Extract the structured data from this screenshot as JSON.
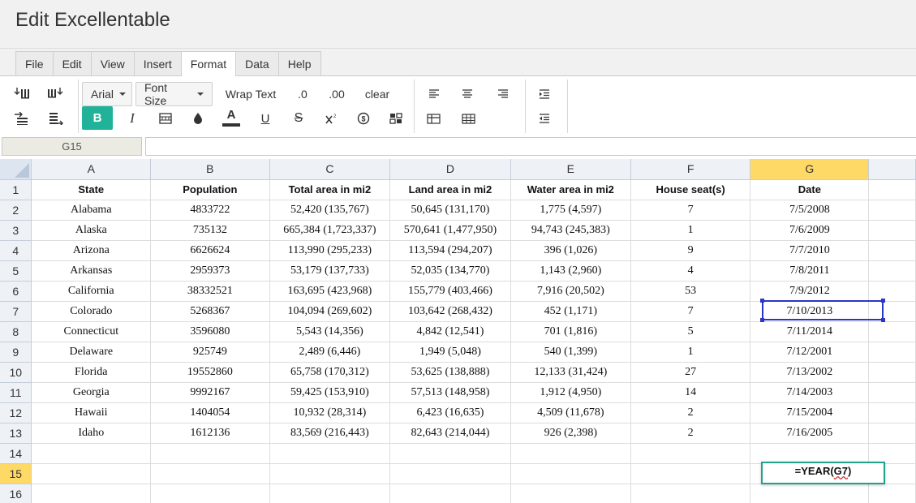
{
  "app": {
    "title": "Edit Excellentable"
  },
  "menu": {
    "items": [
      {
        "label": "File",
        "active": false
      },
      {
        "label": "Edit",
        "active": false
      },
      {
        "label": "View",
        "active": false
      },
      {
        "label": "Insert",
        "active": false
      },
      {
        "label": "Format",
        "active": true
      },
      {
        "label": "Data",
        "active": false
      },
      {
        "label": "Help",
        "active": false
      }
    ]
  },
  "toolbar": {
    "font_family": "Arial",
    "font_size_label": "Font Size",
    "wrap_text_label": "Wrap Text",
    "decrease_decimal_label": ".0",
    "increase_decimal_label": ".00",
    "clear_label": "clear",
    "bold_label": "B",
    "italic_label": "I",
    "text_color_label": "A",
    "underline_label": "U",
    "strike_label": "S",
    "accent_color": "#21b39a"
  },
  "formula_bar": {
    "cell_ref": "G15",
    "value": ""
  },
  "grid": {
    "columns": [
      "A",
      "B",
      "C",
      "D",
      "E",
      "F",
      "G"
    ],
    "selected_column": "G",
    "selected_row": 15,
    "selected_cell": "G7",
    "editing_cell": "G15",
    "editing_value_prefix": "=YEAR(",
    "editing_value_ref": "G7",
    "editing_value_suffix": ")",
    "row_numbers": [
      "1",
      "2",
      "3",
      "4",
      "5",
      "6",
      "7",
      "8",
      "9",
      "10",
      "11",
      "12",
      "13",
      "14",
      "15",
      "16"
    ],
    "header": [
      "State",
      "Population",
      "Total area in mi2",
      "Land area in mi2",
      "Water area in mi2",
      "House seat(s)",
      "Date"
    ],
    "rows": [
      [
        "Alabama",
        "4833722",
        "52,420 (135,767)",
        "50,645 (131,170)",
        "1,775 (4,597)",
        "7",
        "7/5/2008"
      ],
      [
        "Alaska",
        "735132",
        "665,384 (1,723,337)",
        "570,641 (1,477,950)",
        "94,743 (245,383)",
        "1",
        "7/6/2009"
      ],
      [
        "Arizona",
        "6626624",
        "113,990 (295,233)",
        "113,594 (294,207)",
        "396 (1,026)",
        "9",
        "7/7/2010"
      ],
      [
        "Arkansas",
        "2959373",
        "53,179 (137,733)",
        "52,035 (134,770)",
        "1,143 (2,960)",
        "4",
        "7/8/2011"
      ],
      [
        "California",
        "38332521",
        "163,695 (423,968)",
        "155,779 (403,466)",
        "7,916 (20,502)",
        "53",
        "7/9/2012"
      ],
      [
        "Colorado",
        "5268367",
        "104,094 (269,602)",
        "103,642 (268,432)",
        "452 (1,171)",
        "7",
        "7/10/2013"
      ],
      [
        "Connecticut",
        "3596080",
        "5,543 (14,356)",
        "4,842 (12,541)",
        "701 (1,816)",
        "5",
        "7/11/2014"
      ],
      [
        "Delaware",
        "925749",
        "2,489 (6,446)",
        "1,949 (5,048)",
        "540 (1,399)",
        "1",
        "7/12/2001"
      ],
      [
        "Florida",
        "19552860",
        "65,758 (170,312)",
        "53,625 (138,888)",
        "12,133 (31,424)",
        "27",
        "7/13/2002"
      ],
      [
        "Georgia",
        "9992167",
        "59,425 (153,910)",
        "57,513 (148,958)",
        "1,912 (4,950)",
        "14",
        "7/14/2003"
      ],
      [
        "Hawaii",
        "1404054",
        "10,932 (28,314)",
        "6,423 (16,635)",
        "4,509 (11,678)",
        "2",
        "7/15/2004"
      ],
      [
        "Idaho",
        "1612136",
        "83,569 (216,443)",
        "82,643 (214,044)",
        "926 (2,398)",
        "2",
        "7/16/2005"
      ]
    ]
  }
}
